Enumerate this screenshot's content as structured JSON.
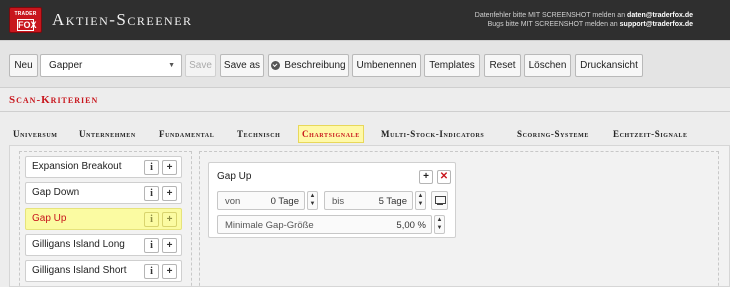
{
  "header": {
    "logo_top": "TRADER",
    "logo_bottom": "FOX",
    "title": "Aktien-Screener",
    "hint1_prefix": "Datenfehler bitte MIT SCREENSHOT melden an",
    "hint1_email": "daten@traderfox.de",
    "hint2_prefix": "Bugs bitte MIT SCREENSHOT melden an",
    "hint2_email": "support@traderfox.de"
  },
  "toolbar": {
    "new": "Neu",
    "screen_select": "Gapper",
    "save": "Save",
    "save_as": "Save as",
    "description": "Beschreibung",
    "rename": "Umbenennen",
    "templates": "Templates",
    "reset": "Reset",
    "delete": "Löschen",
    "print": "Druckansicht"
  },
  "section_title": "Scan-Kriterien",
  "tabs": [
    "Universum",
    "Unternehmen",
    "Fundamental",
    "Technisch",
    "Chartsignale",
    "Multi-Stock-Indicators",
    "Scoring-Systeme",
    "Echtzeit-Signale"
  ],
  "active_tab": "Chartsignale",
  "signals": [
    "Expansion Breakout",
    "Gap Down",
    "Gap Up",
    "Gilligans Island Long",
    "Gilligans Island Short"
  ],
  "active_signal": "Gap Up",
  "panel": {
    "title": "Gap Up",
    "from_label": "von",
    "from_value": "0 Tage",
    "to_label": "bis",
    "to_value": "5 Tage",
    "min_gap_label": "Minimale Gap-Größe",
    "min_gap_value": "5,00 %"
  },
  "colors": {
    "brand_red": "#c8161d",
    "highlight": "#fbfba2"
  }
}
